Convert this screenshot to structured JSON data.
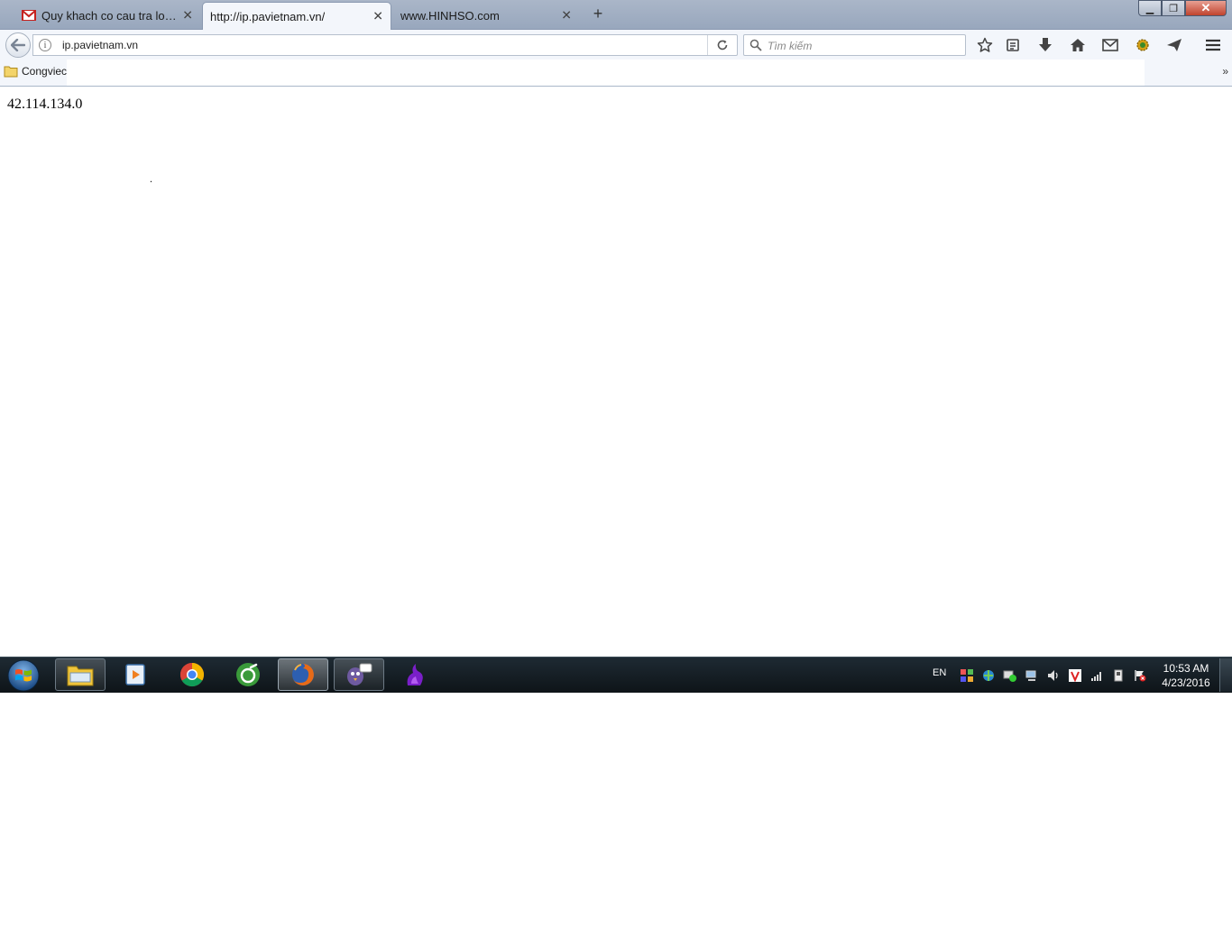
{
  "tabs": [
    {
      "title": "Quy khach co cau tra loi tu...",
      "favicon": "gmail-icon",
      "active": false
    },
    {
      "title": "http://ip.pavietnam.vn/",
      "favicon": "",
      "active": true
    },
    {
      "title": "www.HINHSO.com",
      "favicon": "",
      "active": false
    }
  ],
  "navbar": {
    "url": "ip.pavietnam.vn",
    "search_placeholder": "Tìm kiếm"
  },
  "bookmarks": {
    "folder_label": "Congviec",
    "overflow": "»"
  },
  "content": {
    "ip_address": "42.114.134.0",
    "dot": "."
  },
  "taskbar": {
    "apps": [
      "windows-explorer",
      "media-player",
      "chrome",
      "coc-coc",
      "firefox",
      "pidgin",
      "app-purple"
    ],
    "language": "EN",
    "time": "10:53 AM",
    "date": "4/23/2016"
  },
  "colors": {
    "tabstrip": "#a3b1c5",
    "toolbar": "#f3f6fb",
    "taskbar": "#141c22",
    "close_button": "#c0432d"
  }
}
